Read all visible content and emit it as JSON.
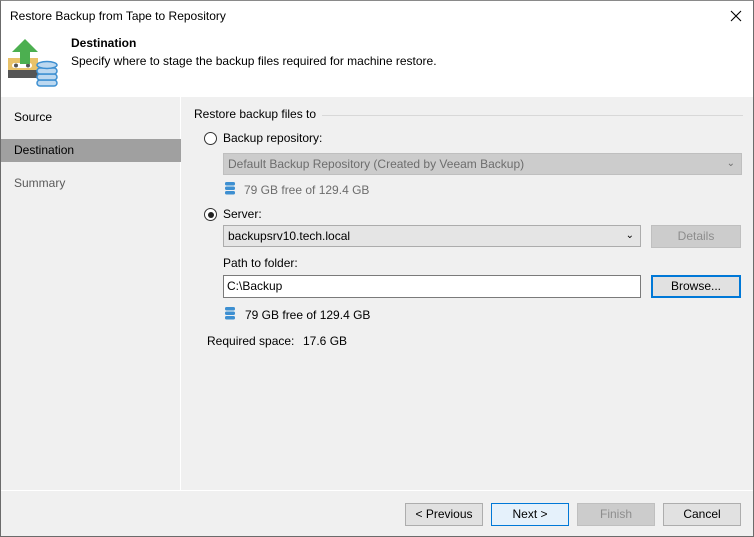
{
  "window": {
    "title": "Restore Backup from Tape to Repository"
  },
  "header": {
    "title": "Destination",
    "description": "Specify where to stage the backup files required for machine restore."
  },
  "sidebar": {
    "items": [
      {
        "label": "Source",
        "state": "normal"
      },
      {
        "label": "Destination",
        "state": "active"
      },
      {
        "label": "Summary",
        "state": "dimmed"
      }
    ]
  },
  "main": {
    "group_label": "Restore backup files to",
    "backup_repository": {
      "label": "Backup repository:",
      "selected": false,
      "combo_value": "Default Backup Repository (Created by Veeam Backup)",
      "free_space": "79 GB free of 129.4 GB"
    },
    "server": {
      "label": "Server:",
      "selected": true,
      "combo_value": "backupsrv10.tech.local",
      "details_label": "Details",
      "path_label": "Path to folder:",
      "path_value": "C:\\Backup",
      "browse_label": "Browse...",
      "free_space": "79 GB free of 129.4 GB"
    },
    "required_space_label": "Required space:",
    "required_space_value": "17.6 GB"
  },
  "footer": {
    "previous_label": "< Previous",
    "next_label": "Next >",
    "finish_label": "Finish",
    "cancel_label": "Cancel"
  },
  "colors": {
    "accent": "#0078d7",
    "sidebar_active": "#a0a0a0",
    "db_icon": "#3d8fd1",
    "arrow_green": "#4caf50"
  }
}
